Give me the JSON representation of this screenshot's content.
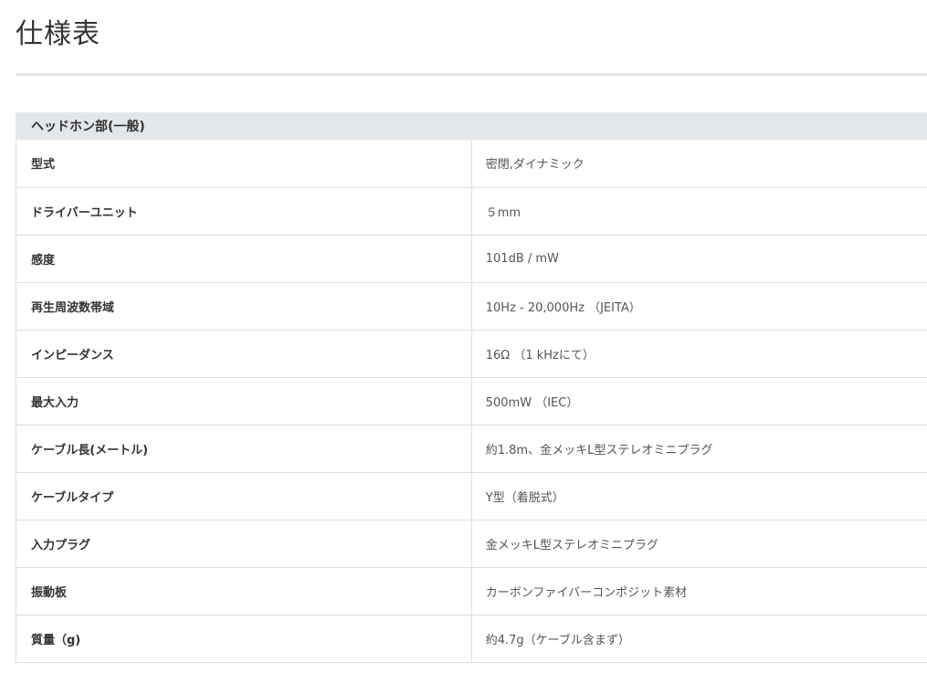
{
  "page": {
    "title": "仕様表"
  },
  "spec_table": {
    "section_header": "ヘッドホン部(一般)",
    "rows": [
      {
        "label": "型式",
        "value": "密閉,ダイナミック"
      },
      {
        "label": "ドライバーユニット",
        "value": "５mm"
      },
      {
        "label": "感度",
        "value": "101dB / mW"
      },
      {
        "label": "再生周波数帯域",
        "value": "10Hz - 20,000Hz （JEITA）"
      },
      {
        "label": "インピーダンス",
        "value": "16Ω （1 kHzにて）"
      },
      {
        "label": "最大入力",
        "value": "500mW （IEC）"
      },
      {
        "label": "ケーブル長(メートル)",
        "value": "約1.8m、金メッキL型ステレオミニプラグ"
      },
      {
        "label": "ケーブルタイプ",
        "value": "Y型（着脱式）"
      },
      {
        "label": "入力プラグ",
        "value": "金メッキL型ステレオミニプラグ"
      },
      {
        "label": "振動板",
        "value": "カーボンファイバーコンポジット素材"
      },
      {
        "label": "質量（g)",
        "value": "約4.7g（ケーブル含まず）"
      }
    ]
  }
}
